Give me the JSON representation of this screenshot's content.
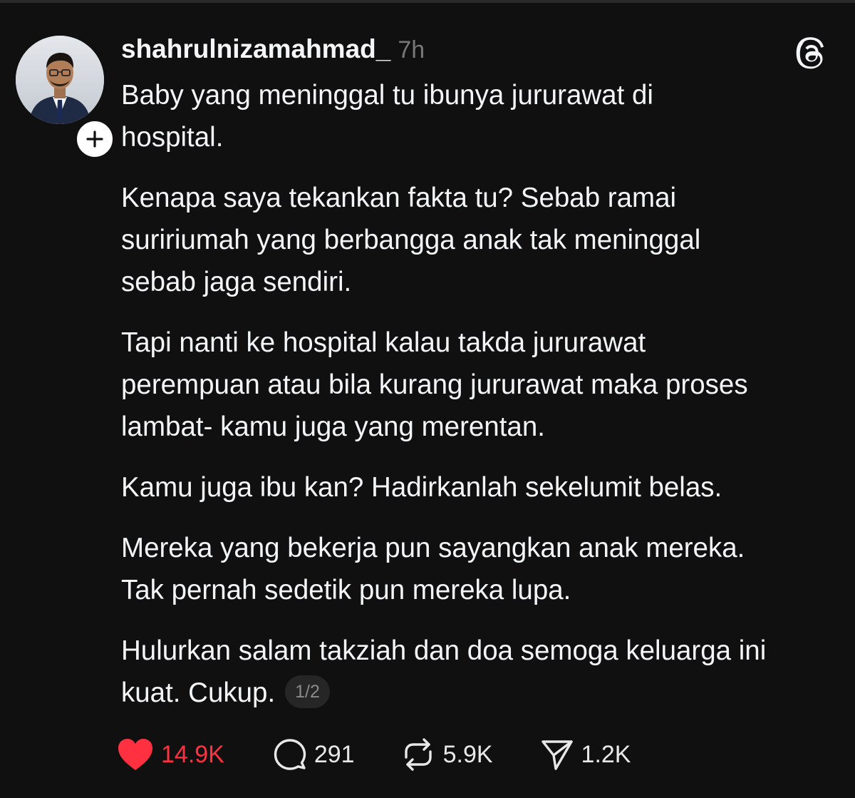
{
  "post": {
    "author": {
      "username": "shahrulnizamahmad_",
      "time_ago": "7h"
    },
    "paragraphs": [
      [
        "Baby yang meninggal tu ibunya jururawat di",
        "hospital."
      ],
      [
        "Kenapa saya tekankan fakta tu? Sebab ramai",
        "suririumah yang berbangga anak tak meninggal",
        "sebab jaga sendiri."
      ],
      [
        "Tapi nanti ke hospital kalau takda jururawat",
        "perempuan atau bila kurang jururawat maka proses",
        "lambat- kamu juga yang merentan."
      ],
      [
        "Kamu juga ibu kan? Hadirkanlah sekelumit belas."
      ],
      [
        "Mereka yang bekerja pun sayangkan anak mereka.",
        "Tak pernah sedetik pun mereka lupa."
      ],
      [
        "Hulurkan salam takziah dan doa semoga keluarga ini",
        "kuat. Cukup."
      ]
    ],
    "page_indicator": "1/2",
    "actions": {
      "likes": "14.9K",
      "replies": "291",
      "reposts": "5.9K",
      "shares": "1.2K"
    }
  },
  "icons": {
    "follow": "plus-icon",
    "app": "threads-logo-icon",
    "like": "heart-icon",
    "reply": "comment-icon",
    "repost": "repost-icon",
    "share": "send-icon"
  },
  "colors": {
    "background": "#101010",
    "text": "#f3f5f7",
    "muted": "#777777",
    "like_active": "#ff3040"
  }
}
